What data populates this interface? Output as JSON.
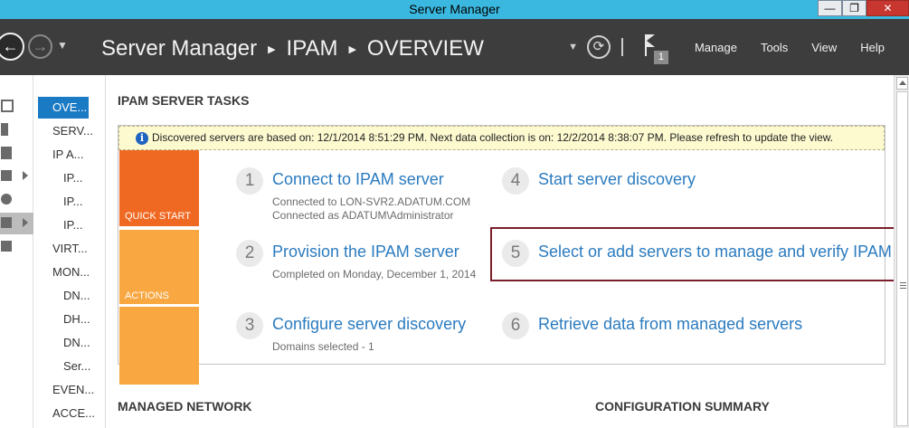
{
  "window": {
    "title": "Server Manager",
    "buttons": {
      "minimize": "—",
      "restore": "❐",
      "close": "✕"
    }
  },
  "toolbar": {
    "back_glyph": "←",
    "forward_glyph": "→",
    "dropdown_glyph": "▼",
    "refresh_glyph": "⟳",
    "breadcrumb": [
      "Server Manager",
      "IPAM",
      "OVERVIEW"
    ],
    "breadcrumb_sep": "▶",
    "notification_count": "1",
    "menu": [
      "Manage",
      "Tools",
      "View",
      "Help"
    ]
  },
  "sidebar": {
    "items": [
      "OVE...",
      "SERV...",
      "IP A...",
      "IP...",
      "IP...",
      "IP...",
      "VIRT...",
      "MON...",
      "DN...",
      "DH...",
      "DN...",
      "Ser...",
      "EVEN...",
      "ACCE..."
    ]
  },
  "content": {
    "section_title": "IPAM SERVER TASKS",
    "info_icon": "i",
    "info_text": "Discovered servers are based on: 12/1/2014 8:51:29 PM. Next data collection is on: 12/2/2014 8:38:07 PM. Please refresh to update the view.",
    "bands": {
      "quick_start": "QUICK START",
      "actions": "ACTIONS"
    },
    "steps": [
      {
        "num": "1",
        "title": "Connect to IPAM server",
        "desc": [
          "Connected to LON-SVR2.ADATUM.COM",
          "Connected as ADATUM\\Administrator"
        ]
      },
      {
        "num": "2",
        "title": "Provision the IPAM server",
        "desc": [
          "Completed on Monday, December 1, 2014"
        ]
      },
      {
        "num": "3",
        "title": "Configure server discovery",
        "desc": [
          "Domains selected - 1"
        ]
      },
      {
        "num": "4",
        "title": "Start server discovery",
        "desc": []
      },
      {
        "num": "5",
        "title": "Select or add servers to manage and verify IPAM",
        "desc": []
      },
      {
        "num": "6",
        "title": "Retrieve data from managed servers",
        "desc": []
      }
    ],
    "managed_network": "MANAGED NETWORK",
    "config_summary": "CONFIGURATION SUMMARY"
  },
  "colors": {
    "titlebar": "#3bb8e0",
    "toolbar": "#3d3d3d",
    "selected": "#1a7ac4",
    "quick_start": "#f06922",
    "actions": "#f8a741",
    "link": "#2b7bbf",
    "highlight_border": "#7a1f2a"
  }
}
